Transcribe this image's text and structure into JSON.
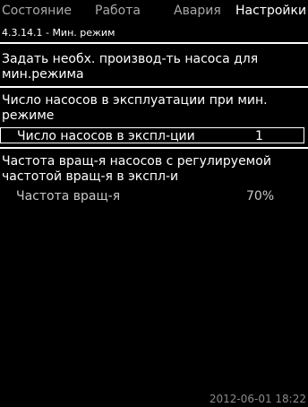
{
  "tabs": [
    "Состояние",
    "Работа",
    "Авария",
    "Настройки"
  ],
  "breadcrumb": "4.3.14.1 - Мин. режим",
  "description": "Задать необх. производ-ть насоса для мин.режима",
  "section1": {
    "heading": "Число насосов в эксплуатации при мин. режиме",
    "row": {
      "label": "Число насосов в экспл-ции",
      "value": "1"
    }
  },
  "section2": {
    "heading": "Частота вращ-я насосов с регулируемой частотой вращ-я в экспл-и",
    "row": {
      "label": "Частота вращ-я",
      "value": "70%"
    }
  },
  "footer": {
    "datetime": "2012-06-01 18:22"
  }
}
